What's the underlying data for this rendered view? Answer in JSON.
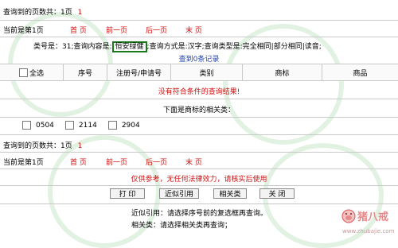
{
  "top_summary": {
    "label": "查询到的页数共：1页",
    "num": "1"
  },
  "top_nav": {
    "current_label": "当前是第1页",
    "first": "首 页",
    "prev": "前一页",
    "next": "后一页",
    "last": "末 页"
  },
  "query_info": {
    "prefix": "类号是：31;查询内容是:",
    "term": "恒安绿健",
    "suffix": ";查询方式是:汉字;查询类型是:完全相同|部分相同|读音;",
    "records": "查到0条记录"
  },
  "table_header": {
    "select_all": "全选",
    "seq": "序号",
    "reg_no": "注册号/申请号",
    "category": "类别",
    "trademark": "商标",
    "goods": "商品"
  },
  "no_result": "没有符合条件的查询结果!",
  "related_title": "下面是商标的相关类：",
  "related_classes": [
    "0504",
    "2114",
    "2904"
  ],
  "bottom_summary": {
    "label": "查询到的页数共：1页",
    "num": "1"
  },
  "bottom_nav": {
    "current_label": "当前是第1页",
    "first": "首 页",
    "prev": "前一页",
    "next": "后一页",
    "last": "末 页"
  },
  "disclaimer": "仅供参考，无任何法律效力，请核实后使用",
  "buttons": {
    "print": "打 印",
    "similar": "近似引用",
    "related": "相关类",
    "close": "关 闭"
  },
  "help": {
    "line1": "近似引用：请选择序号前的复选框再查询。",
    "line2": "相关类：请选择相关类再查询；"
  },
  "brand": {
    "logo_chars": "猪八戒",
    "url": "www.zhubajie.com"
  }
}
